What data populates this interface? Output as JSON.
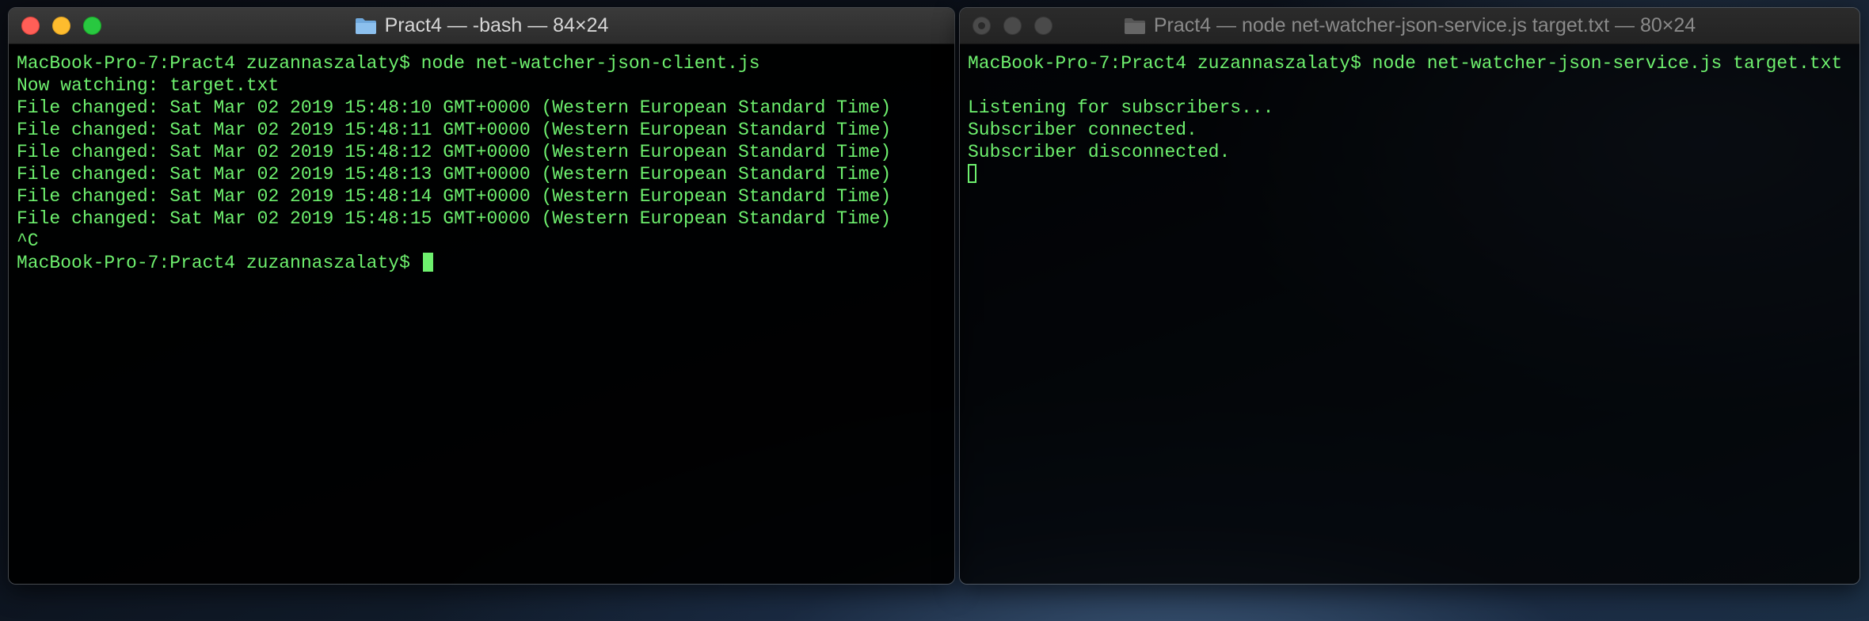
{
  "colors": {
    "terminal_text": "#6ef06e",
    "close": "#ff5f57",
    "minimize": "#febc2e",
    "maximize": "#28c840"
  },
  "left_window": {
    "title": "Pract4 — -bash — 84×24",
    "lines": [
      "MacBook-Pro-7:Pract4 zuzannaszalaty$ node net-watcher-json-client.js",
      "Now watching: target.txt",
      "File changed: Sat Mar 02 2019 15:48:10 GMT+0000 (Western European Standard Time)",
      "File changed: Sat Mar 02 2019 15:48:11 GMT+0000 (Western European Standard Time)",
      "File changed: Sat Mar 02 2019 15:48:12 GMT+0000 (Western European Standard Time)",
      "File changed: Sat Mar 02 2019 15:48:13 GMT+0000 (Western European Standard Time)",
      "File changed: Sat Mar 02 2019 15:48:14 GMT+0000 (Western European Standard Time)",
      "File changed: Sat Mar 02 2019 15:48:15 GMT+0000 (Western European Standard Time)",
      "^C"
    ],
    "prompt": "MacBook-Pro-7:Pract4 zuzannaszalaty$ "
  },
  "right_window": {
    "title": "Pract4 — node net-watcher-json-service.js target.txt — 80×24",
    "lines": [
      "MacBook-Pro-7:Pract4 zuzannaszalaty$ node net-watcher-json-service.js target.txt",
      "",
      "Listening for subscribers...",
      "Subscriber connected.",
      "Subscriber disconnected."
    ]
  },
  "icons": [
    "folder-icon",
    "close-button",
    "minimize-button",
    "maximize-button",
    "cursor"
  ]
}
